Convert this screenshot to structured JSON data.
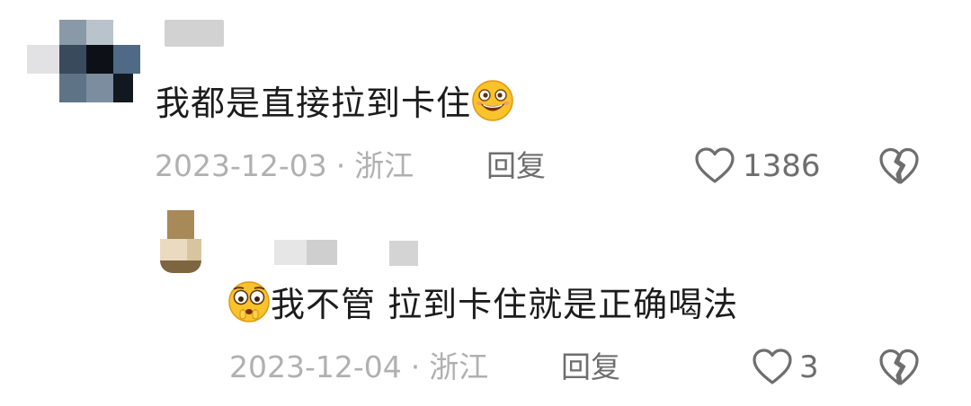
{
  "comments": [
    {
      "text": "我都是直接拉到卡住",
      "emoji_after": "grinning-face-emoji",
      "date": "2023-12-03",
      "separator": "·",
      "location": "浙江",
      "reply_label": "回复",
      "like_count": "1386"
    },
    {
      "text": "我不管 拉到卡住就是正确喝法",
      "emoji_before": "pleading-face-emoji",
      "date": "2023-12-04",
      "separator": "·",
      "location": "浙江",
      "reply_label": "回复",
      "like_count": "3"
    }
  ],
  "colors": {
    "meta_text": "#b0b0b0",
    "action_text": "#6e6e6e",
    "body_text": "#1c1c1c",
    "emoji_yellow": "#f9c32b"
  }
}
